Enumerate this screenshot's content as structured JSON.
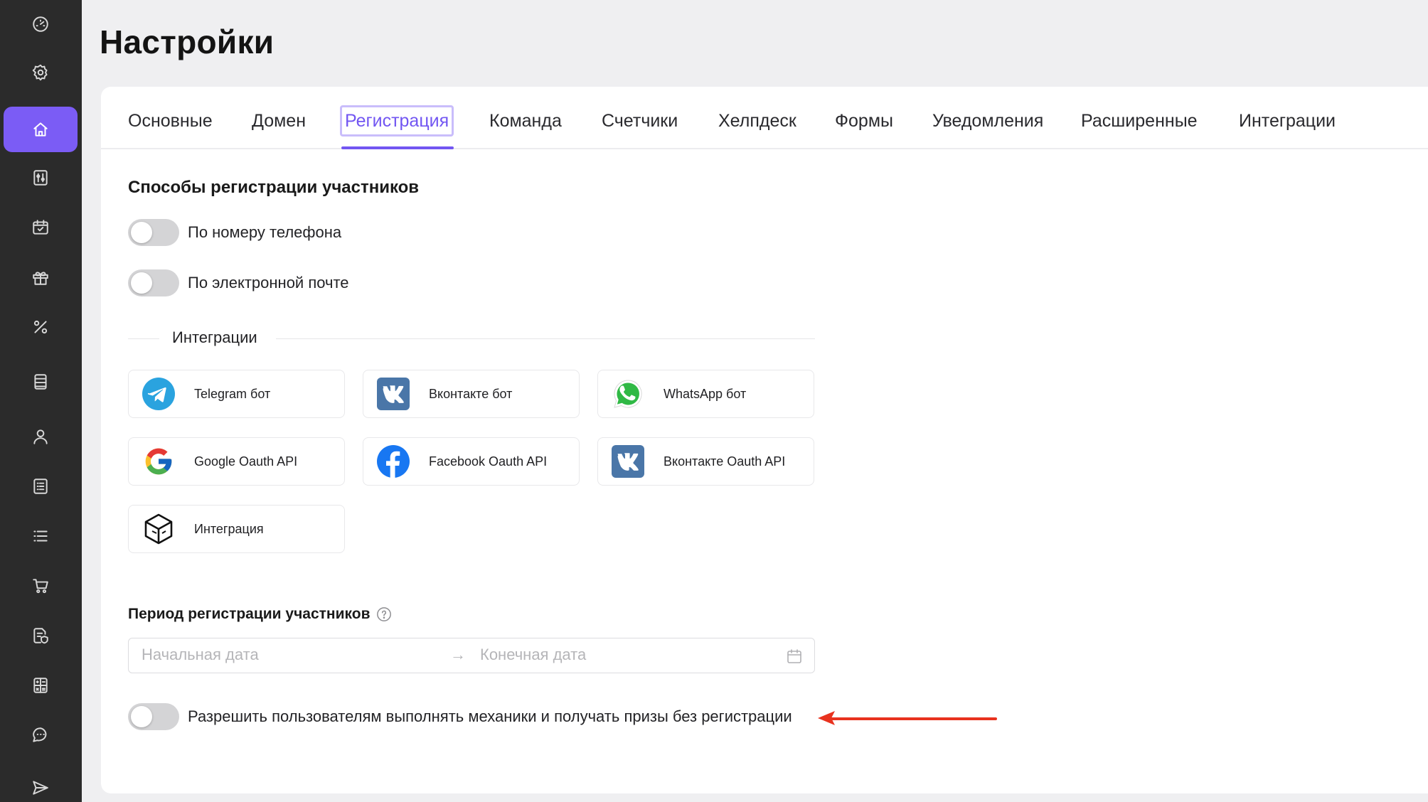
{
  "page": {
    "title": "Настройки"
  },
  "sidebar": {
    "items": [
      {
        "icon": "dashboard-icon"
      },
      {
        "icon": "gear-icon"
      },
      {
        "icon": "home-icon",
        "active": true
      },
      {
        "icon": "sliders-icon"
      },
      {
        "icon": "calendar-check-icon"
      },
      {
        "icon": "gift-icon"
      },
      {
        "icon": "percent-icon"
      },
      {
        "icon": "database-icon"
      },
      {
        "icon": "user-icon"
      },
      {
        "icon": "list-box-icon"
      },
      {
        "icon": "list-icon"
      },
      {
        "icon": "cart-icon"
      },
      {
        "icon": "document-shield-icon"
      },
      {
        "icon": "calculator-icon"
      },
      {
        "icon": "chat-icon"
      },
      {
        "icon": "send-icon"
      }
    ]
  },
  "tabs": [
    {
      "label": "Основные"
    },
    {
      "label": "Домен"
    },
    {
      "label": "Регистрация",
      "active": true
    },
    {
      "label": "Команда"
    },
    {
      "label": "Счетчики"
    },
    {
      "label": "Хелпдеск"
    },
    {
      "label": "Формы"
    },
    {
      "label": "Уведомления"
    },
    {
      "label": "Расширенные"
    },
    {
      "label": "Интеграции"
    }
  ],
  "registration": {
    "title": "Способы регистрации участников",
    "phone_toggle": {
      "label": "По номеру телефона",
      "on": false
    },
    "email_toggle": {
      "label": "По электронной почте",
      "on": false
    },
    "integrations_divider": "Интеграции",
    "integrations": [
      {
        "label": "Telegram бот",
        "icon": "telegram-icon"
      },
      {
        "label": "Вконтакте бот",
        "icon": "vk-icon"
      },
      {
        "label": "WhatsApp бот",
        "icon": "whatsapp-icon"
      },
      {
        "label": "Google Oauth API",
        "icon": "google-icon"
      },
      {
        "label": "Facebook Oauth API",
        "icon": "facebook-icon"
      },
      {
        "label": "Вконтакте Oauth API",
        "icon": "vk-icon"
      },
      {
        "label": "Интеграция",
        "icon": "integration-cube-icon"
      }
    ]
  },
  "period": {
    "title": "Период регистрации участников",
    "start_placeholder": "Начальная дата",
    "end_placeholder": "Конечная дата",
    "separator": "→"
  },
  "guest_toggle": {
    "label": "Разрешить пользователям выполнять механики и получать призы без регистрации",
    "on": false
  },
  "colors": {
    "accent": "#7256f2",
    "sidebar_bg": "#2b2b2b",
    "annotation": "#e8321e"
  }
}
